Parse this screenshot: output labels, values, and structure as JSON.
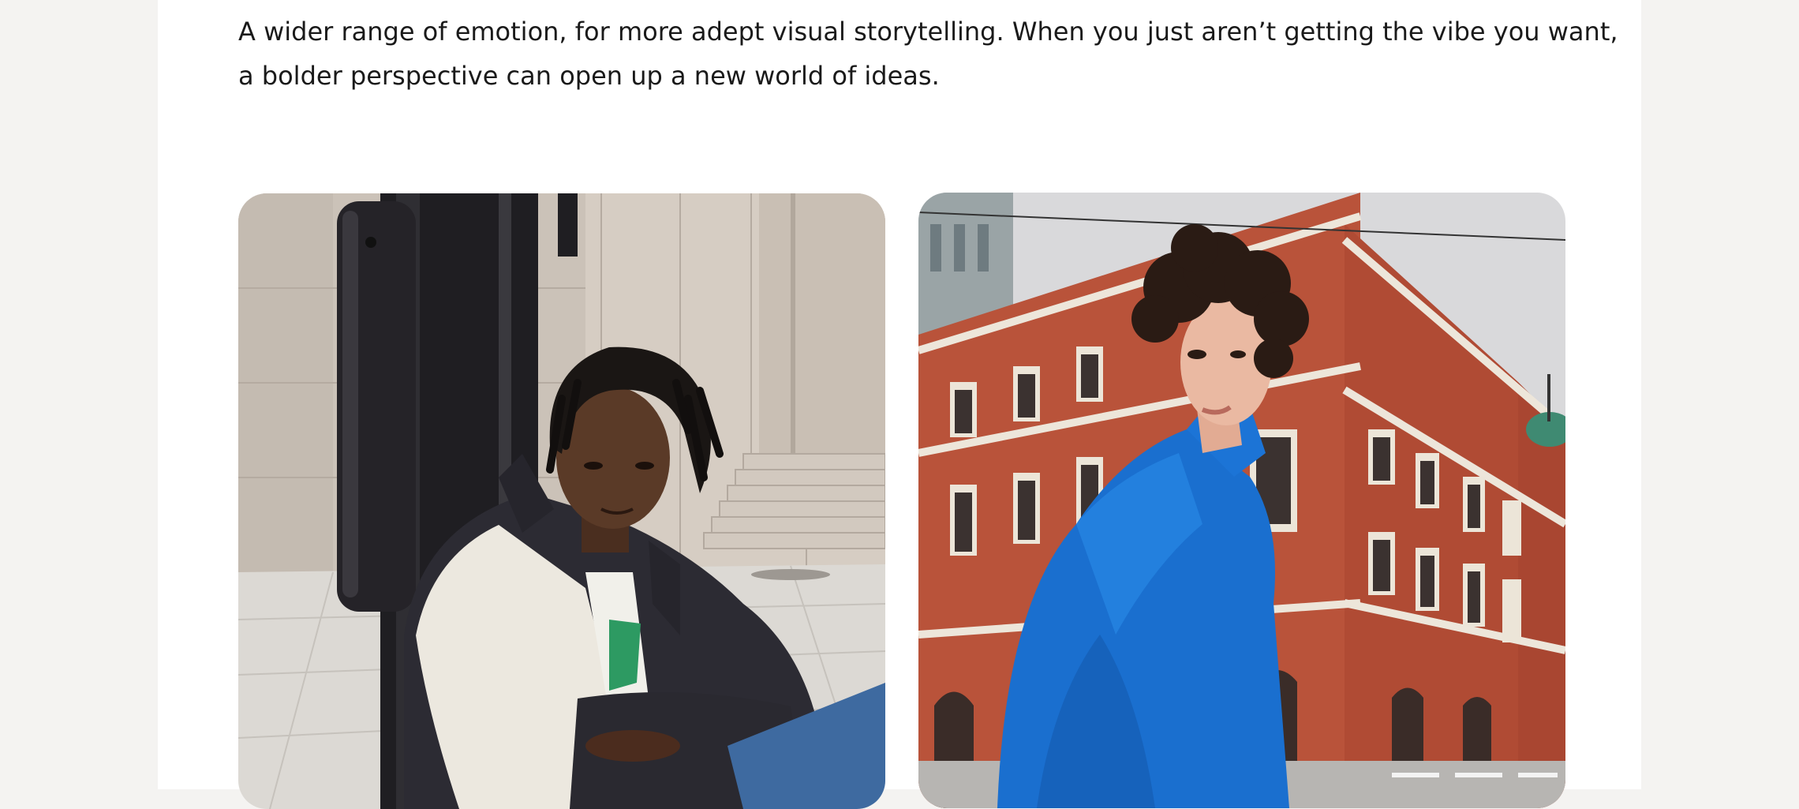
{
  "intro": {
    "line1": "A wider range of emotion, for more adept visual storytelling. When you just aren’t getting the vibe you want,",
    "line2": "a bolder perspective can open up a new world of ideas."
  },
  "gallery": {
    "photos": [
      {
        "subject": "man in dark varsity jacket sitting against a metal pole",
        "palette": {
          "wall": "#cfc6bd",
          "floor": "#d9d6d1",
          "pole": "#2b2a2e",
          "jacket": "#2c2b33",
          "skin": "#5a3a27"
        }
      },
      {
        "subject": "man in blue hoodie in front of a red brick historic building",
        "palette": {
          "sky": "#d8d8da",
          "brick": "#b8523a",
          "trim": "#e9e2d6",
          "hoodie": "#1a6fcf",
          "hair": "#2a1b14",
          "skin": "#e8b59e"
        }
      }
    ]
  },
  "colors": {
    "page_bg": "#f4f3f1",
    "panel_bg": "#ffffff",
    "text": "#1a1a1a"
  }
}
